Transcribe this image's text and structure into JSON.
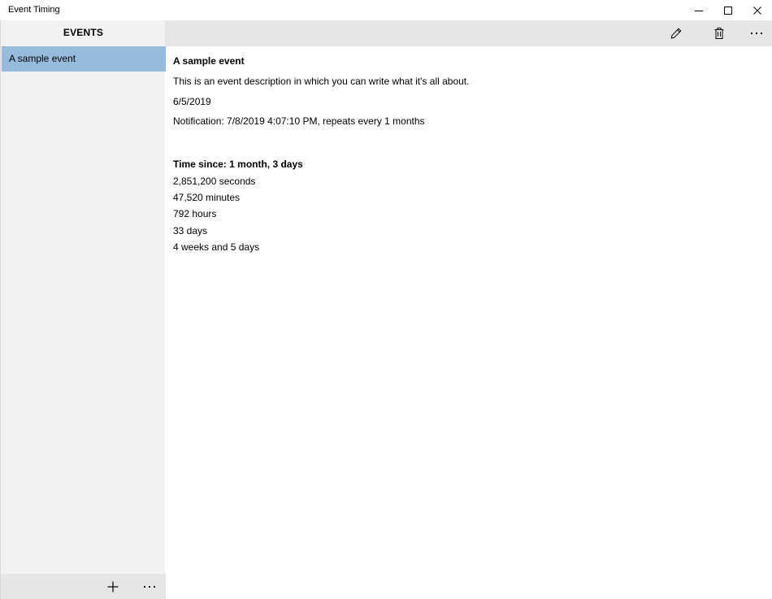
{
  "window": {
    "title": "Event Timing",
    "controls": [
      "minimize-icon",
      "maximize-icon",
      "close-icon"
    ]
  },
  "sidebar": {
    "header": "EVENTS",
    "items": [
      {
        "label": "A sample event",
        "selected": true
      }
    ],
    "footer_icons": [
      "add-icon",
      "more-icon"
    ],
    "selected_color": "#97bbdd"
  },
  "toolbar": {
    "icons": [
      "edit-pencil-icon",
      "delete-trash-icon",
      "more-icon"
    ]
  },
  "event": {
    "title": "A sample event",
    "description": "This is an event description in which you can write what it's all about.",
    "date": "6/5/2019",
    "notification": "Notification: 7/8/2019 4:07:10 PM, repeats every 1 months",
    "time_since_heading": "Time since: 1 month, 3 days",
    "seconds": "2,851,200 seconds",
    "minutes": "47,520 minutes",
    "hours": "792 hours",
    "days": "33 days",
    "weeks": "4 weeks and 5 days"
  }
}
